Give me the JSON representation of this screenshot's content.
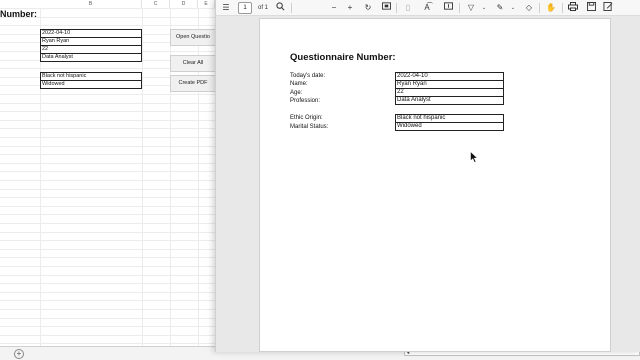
{
  "spreadsheet": {
    "title": "Number:",
    "columns": [
      "B",
      "C",
      "D",
      "E"
    ],
    "cells": [
      "2022-04-10",
      "Ryan Ryan",
      "22",
      "Data Analyst"
    ],
    "cells2": [
      "Black not hispanic",
      "Widowed"
    ],
    "buttons": [
      "Open Questio",
      "Clear All",
      "Create PDF"
    ],
    "add_sheet_glyph": "+"
  },
  "pdf_viewer": {
    "page_number": "1",
    "page_of": "of 1",
    "toolbar_icons": [
      "contents-icon",
      "search-icon",
      "zoom-out-icon",
      "zoom-in-icon",
      "rotate-icon",
      "fit-page-icon",
      "page-view-icon",
      "read-aloud-icon",
      "text-icon",
      "highlight-icon",
      "draw-icon",
      "erase-icon",
      "touch-icon",
      "print-icon",
      "save-icon",
      "save-as-icon"
    ],
    "document": {
      "title": "Questionnaire Number:",
      "fields": [
        {
          "label": "Today's date:",
          "value": "2022-04-10"
        },
        {
          "label": "Name:",
          "value": "Ryan Ryan"
        },
        {
          "label": "Age:",
          "value": "22"
        },
        {
          "label": "Profession:",
          "value": "Data Analyst"
        }
      ],
      "fields2": [
        {
          "label": "Ethic Origin:",
          "value": "Black not hispanic"
        },
        {
          "label": "Marital Status:",
          "value": "Widowed"
        }
      ]
    }
  }
}
